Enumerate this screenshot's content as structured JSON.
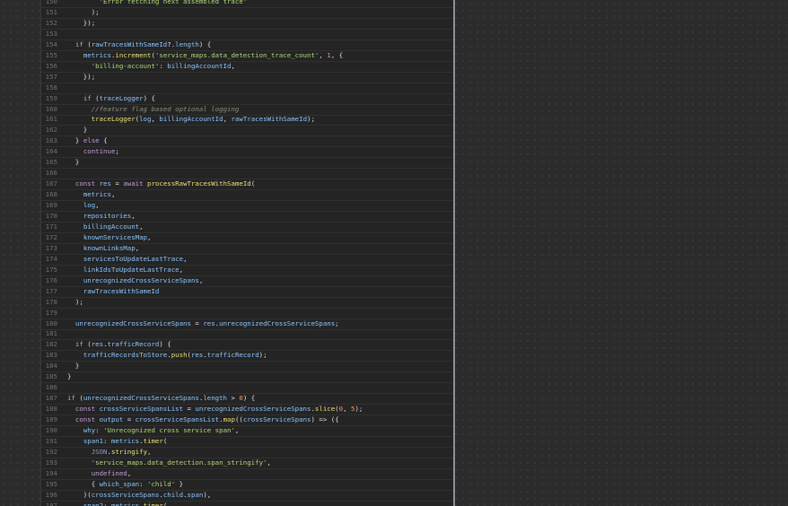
{
  "lines": [
    {
      "num": "150",
      "tokens": [
        {
          "t": "s",
          "v": "        'Error fetching next assembled trace'"
        }
      ]
    },
    {
      "num": "151",
      "tokens": [
        {
          "t": "p",
          "v": "      );"
        }
      ]
    },
    {
      "num": "152",
      "tokens": [
        {
          "t": "p",
          "v": "    });"
        }
      ]
    },
    {
      "num": "153",
      "tokens": []
    },
    {
      "num": "154",
      "tokens": [
        {
          "t": "p",
          "v": "  "
        },
        {
          "t": "k",
          "v": "if"
        },
        {
          "t": "p",
          "v": " ("
        },
        {
          "t": "v",
          "v": "rawTracesWithSameId"
        },
        {
          "t": "p",
          "v": "?."
        },
        {
          "t": "v",
          "v": "length"
        },
        {
          "t": "p",
          "v": ") {"
        }
      ]
    },
    {
      "num": "155",
      "tokens": [
        {
          "t": "p",
          "v": "    "
        },
        {
          "t": "v",
          "v": "metrics"
        },
        {
          "t": "p",
          "v": "."
        },
        {
          "t": "fn",
          "v": "increment"
        },
        {
          "t": "p",
          "v": "("
        },
        {
          "t": "s",
          "v": "'service_maps.data_detection_trace_count'"
        },
        {
          "t": "p",
          "v": ", "
        },
        {
          "t": "n",
          "v": "1"
        },
        {
          "t": "p",
          "v": ", {"
        }
      ]
    },
    {
      "num": "156",
      "tokens": [
        {
          "t": "p",
          "v": "      "
        },
        {
          "t": "s",
          "v": "'billing-account'"
        },
        {
          "t": "p",
          "v": ": "
        },
        {
          "t": "v",
          "v": "billingAccountId"
        },
        {
          "t": "p",
          "v": ","
        }
      ]
    },
    {
      "num": "157",
      "tokens": [
        {
          "t": "p",
          "v": "    });"
        }
      ]
    },
    {
      "num": "158",
      "tokens": []
    },
    {
      "num": "159",
      "tokens": [
        {
          "t": "p",
          "v": "    "
        },
        {
          "t": "k",
          "v": "if"
        },
        {
          "t": "p",
          "v": " ("
        },
        {
          "t": "v",
          "v": "traceLogger"
        },
        {
          "t": "p",
          "v": ") {"
        }
      ]
    },
    {
      "num": "160",
      "tokens": [
        {
          "t": "c",
          "v": "      //feature flag based optional logging"
        }
      ]
    },
    {
      "num": "161",
      "tokens": [
        {
          "t": "p",
          "v": "      "
        },
        {
          "t": "fn",
          "v": "traceLogger"
        },
        {
          "t": "p",
          "v": "("
        },
        {
          "t": "v",
          "v": "log"
        },
        {
          "t": "p",
          "v": ", "
        },
        {
          "t": "v",
          "v": "billingAccountId"
        },
        {
          "t": "p",
          "v": ", "
        },
        {
          "t": "v",
          "v": "rawTracesWithSameId"
        },
        {
          "t": "p",
          "v": ");"
        }
      ]
    },
    {
      "num": "162",
      "tokens": [
        {
          "t": "p",
          "v": "    }"
        }
      ]
    },
    {
      "num": "163",
      "tokens": [
        {
          "t": "p",
          "v": "  } "
        },
        {
          "t": "k",
          "v": "else"
        },
        {
          "t": "p",
          "v": " {"
        }
      ]
    },
    {
      "num": "164",
      "tokens": [
        {
          "t": "p",
          "v": "    "
        },
        {
          "t": "k",
          "v": "continue"
        },
        {
          "t": "p",
          "v": ";"
        }
      ]
    },
    {
      "num": "165",
      "tokens": [
        {
          "t": "p",
          "v": "  }"
        }
      ]
    },
    {
      "num": "166",
      "tokens": []
    },
    {
      "num": "167",
      "tokens": [
        {
          "t": "p",
          "v": "  "
        },
        {
          "t": "k",
          "v": "const"
        },
        {
          "t": "p",
          "v": " "
        },
        {
          "t": "v",
          "v": "res"
        },
        {
          "t": "p",
          "v": " = "
        },
        {
          "t": "k",
          "v": "await"
        },
        {
          "t": "p",
          "v": " "
        },
        {
          "t": "fn",
          "v": "processRawTracesWithSameId"
        },
        {
          "t": "p",
          "v": "("
        }
      ]
    },
    {
      "num": "168",
      "tokens": [
        {
          "t": "p",
          "v": "    "
        },
        {
          "t": "v",
          "v": "metrics"
        },
        {
          "t": "p",
          "v": ","
        }
      ]
    },
    {
      "num": "169",
      "tokens": [
        {
          "t": "p",
          "v": "    "
        },
        {
          "t": "v",
          "v": "log"
        },
        {
          "t": "p",
          "v": ","
        }
      ]
    },
    {
      "num": "170",
      "tokens": [
        {
          "t": "p",
          "v": "    "
        },
        {
          "t": "v",
          "v": "repositories"
        },
        {
          "t": "p",
          "v": ","
        }
      ]
    },
    {
      "num": "171",
      "tokens": [
        {
          "t": "p",
          "v": "    "
        },
        {
          "t": "v",
          "v": "billingAccount"
        },
        {
          "t": "p",
          "v": ","
        }
      ]
    },
    {
      "num": "172",
      "tokens": [
        {
          "t": "p",
          "v": "    "
        },
        {
          "t": "v",
          "v": "knownServicesMap"
        },
        {
          "t": "p",
          "v": ","
        }
      ]
    },
    {
      "num": "173",
      "tokens": [
        {
          "t": "p",
          "v": "    "
        },
        {
          "t": "v",
          "v": "knownLinksMap"
        },
        {
          "t": "p",
          "v": ","
        }
      ]
    },
    {
      "num": "174",
      "tokens": [
        {
          "t": "p",
          "v": "    "
        },
        {
          "t": "v",
          "v": "servicesToUpdateLastTrace"
        },
        {
          "t": "p",
          "v": ","
        }
      ]
    },
    {
      "num": "175",
      "tokens": [
        {
          "t": "p",
          "v": "    "
        },
        {
          "t": "v",
          "v": "linkIdsToUpdateLastTrace"
        },
        {
          "t": "p",
          "v": ","
        }
      ]
    },
    {
      "num": "176",
      "tokens": [
        {
          "t": "p",
          "v": "    "
        },
        {
          "t": "v",
          "v": "unrecognizedCrossServiceSpans"
        },
        {
          "t": "p",
          "v": ","
        }
      ]
    },
    {
      "num": "177",
      "tokens": [
        {
          "t": "p",
          "v": "    "
        },
        {
          "t": "v",
          "v": "rawTracesWithSameId"
        }
      ]
    },
    {
      "num": "178",
      "tokens": [
        {
          "t": "p",
          "v": "  );"
        }
      ]
    },
    {
      "num": "179",
      "tokens": []
    },
    {
      "num": "180",
      "tokens": [
        {
          "t": "p",
          "v": "  "
        },
        {
          "t": "v",
          "v": "unrecognizedCrossServiceSpans"
        },
        {
          "t": "p",
          "v": " = "
        },
        {
          "t": "v",
          "v": "res"
        },
        {
          "t": "p",
          "v": "."
        },
        {
          "t": "v",
          "v": "unrecognizedCrossServiceSpans"
        },
        {
          "t": "p",
          "v": ";"
        }
      ]
    },
    {
      "num": "181",
      "tokens": []
    },
    {
      "num": "182",
      "tokens": [
        {
          "t": "p",
          "v": "  "
        },
        {
          "t": "k",
          "v": "if"
        },
        {
          "t": "p",
          "v": " ("
        },
        {
          "t": "v",
          "v": "res"
        },
        {
          "t": "p",
          "v": "."
        },
        {
          "t": "v",
          "v": "trafficRecord"
        },
        {
          "t": "p",
          "v": ") {"
        }
      ]
    },
    {
      "num": "183",
      "tokens": [
        {
          "t": "p",
          "v": "    "
        },
        {
          "t": "v",
          "v": "trafficRecordsToStore"
        },
        {
          "t": "p",
          "v": "."
        },
        {
          "t": "fn",
          "v": "push"
        },
        {
          "t": "p",
          "v": "("
        },
        {
          "t": "v",
          "v": "res"
        },
        {
          "t": "p",
          "v": "."
        },
        {
          "t": "v",
          "v": "trafficRecord"
        },
        {
          "t": "p",
          "v": ");"
        }
      ]
    },
    {
      "num": "184",
      "tokens": [
        {
          "t": "p",
          "v": "  }"
        }
      ]
    },
    {
      "num": "185",
      "tokens": [
        {
          "t": "p",
          "v": "}"
        }
      ]
    },
    {
      "num": "186",
      "tokens": []
    },
    {
      "num": "187",
      "tokens": [
        {
          "t": "k",
          "v": "if"
        },
        {
          "t": "p",
          "v": " ("
        },
        {
          "t": "v",
          "v": "unrecognizedCrossServiceSpans"
        },
        {
          "t": "p",
          "v": "."
        },
        {
          "t": "v",
          "v": "length"
        },
        {
          "t": "p",
          "v": " > "
        },
        {
          "t": "n",
          "v": "0"
        },
        {
          "t": "p",
          "v": ") {"
        }
      ]
    },
    {
      "num": "188",
      "tokens": [
        {
          "t": "p",
          "v": "  "
        },
        {
          "t": "k",
          "v": "const"
        },
        {
          "t": "p",
          "v": " "
        },
        {
          "t": "v",
          "v": "crossServiceSpansList"
        },
        {
          "t": "p",
          "v": " = "
        },
        {
          "t": "v",
          "v": "unrecognizedCrossServiceSpans"
        },
        {
          "t": "p",
          "v": "."
        },
        {
          "t": "fn",
          "v": "slice"
        },
        {
          "t": "p",
          "v": "("
        },
        {
          "t": "n",
          "v": "0"
        },
        {
          "t": "p",
          "v": ", "
        },
        {
          "t": "n",
          "v": "5"
        },
        {
          "t": "p",
          "v": ");"
        }
      ]
    },
    {
      "num": "189",
      "tokens": [
        {
          "t": "p",
          "v": "  "
        },
        {
          "t": "k",
          "v": "const"
        },
        {
          "t": "p",
          "v": " "
        },
        {
          "t": "v",
          "v": "output"
        },
        {
          "t": "p",
          "v": " = "
        },
        {
          "t": "v",
          "v": "crossServiceSpansList"
        },
        {
          "t": "p",
          "v": "."
        },
        {
          "t": "fn",
          "v": "map"
        },
        {
          "t": "p",
          "v": "(("
        },
        {
          "t": "v",
          "v": "crossServiceSpans"
        },
        {
          "t": "p",
          "v": ") => ({"
        }
      ]
    },
    {
      "num": "190",
      "tokens": [
        {
          "t": "p",
          "v": "    "
        },
        {
          "t": "v",
          "v": "why"
        },
        {
          "t": "p",
          "v": ": "
        },
        {
          "t": "s",
          "v": "'Unrecognized cross service span'"
        },
        {
          "t": "p",
          "v": ","
        }
      ]
    },
    {
      "num": "191",
      "tokens": [
        {
          "t": "p",
          "v": "    "
        },
        {
          "t": "v",
          "v": "span1"
        },
        {
          "t": "p",
          "v": ": "
        },
        {
          "t": "v",
          "v": "metrics"
        },
        {
          "t": "p",
          "v": "."
        },
        {
          "t": "fn",
          "v": "timer"
        },
        {
          "t": "p",
          "v": "("
        }
      ]
    },
    {
      "num": "192",
      "tokens": [
        {
          "t": "p",
          "v": "      "
        },
        {
          "t": "dim",
          "v": "JSON"
        },
        {
          "t": "p",
          "v": "."
        },
        {
          "t": "fn",
          "v": "stringify"
        },
        {
          "t": "p",
          "v": ","
        }
      ]
    },
    {
      "num": "193",
      "tokens": [
        {
          "t": "p",
          "v": "      "
        },
        {
          "t": "s",
          "v": "'service_maps.data_detection.span_stringify'"
        },
        {
          "t": "p",
          "v": ","
        }
      ]
    },
    {
      "num": "194",
      "tokens": [
        {
          "t": "p",
          "v": "      "
        },
        {
          "t": "k",
          "v": "undefined"
        },
        {
          "t": "p",
          "v": ","
        }
      ]
    },
    {
      "num": "195",
      "tokens": [
        {
          "t": "p",
          "v": "      { "
        },
        {
          "t": "v",
          "v": "which_span"
        },
        {
          "t": "p",
          "v": ": "
        },
        {
          "t": "s",
          "v": "'child'"
        },
        {
          "t": "p",
          "v": " }"
        }
      ]
    },
    {
      "num": "196",
      "tokens": [
        {
          "t": "p",
          "v": "    )("
        },
        {
          "t": "v",
          "v": "crossServiceSpans"
        },
        {
          "t": "p",
          "v": "."
        },
        {
          "t": "v",
          "v": "child"
        },
        {
          "t": "p",
          "v": "."
        },
        {
          "t": "v",
          "v": "span"
        },
        {
          "t": "p",
          "v": "),"
        }
      ]
    },
    {
      "num": "197",
      "tokens": [
        {
          "t": "p",
          "v": "    "
        },
        {
          "t": "v",
          "v": "span2"
        },
        {
          "t": "p",
          "v": ": "
        },
        {
          "t": "v",
          "v": "metrics"
        },
        {
          "t": "p",
          "v": "."
        },
        {
          "t": "fn",
          "v": "timer"
        },
        {
          "t": "p",
          "v": "("
        }
      ]
    }
  ]
}
